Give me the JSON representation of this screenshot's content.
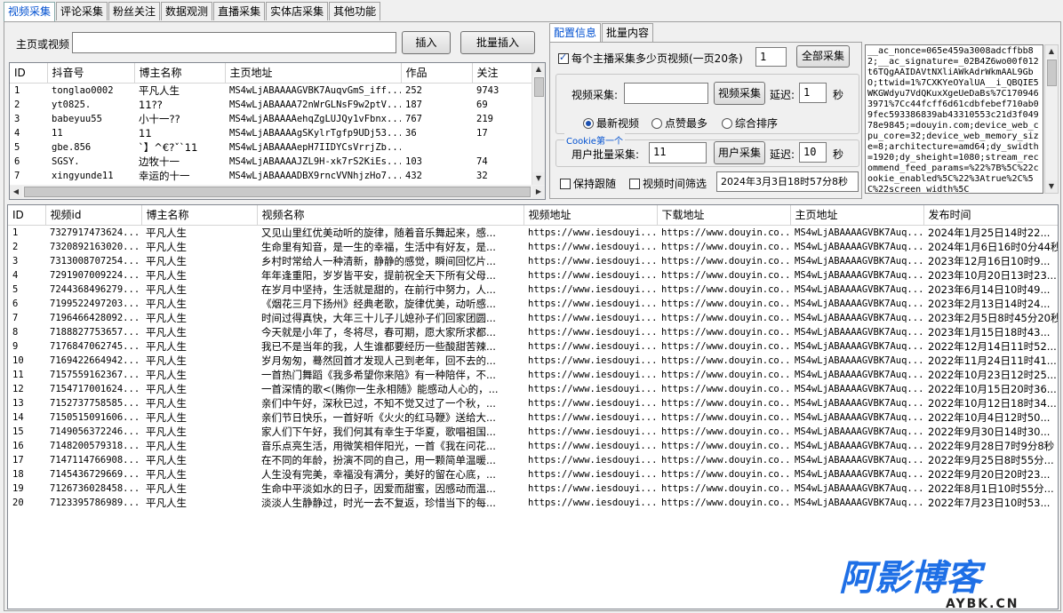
{
  "main_tabs": [
    "视频采集",
    "评论采集",
    "粉丝关注",
    "数据观测",
    "直播采集",
    "实体店采集",
    "其他功能"
  ],
  "top_form": {
    "homepage_label": "主页或视频",
    "homepage_value": "",
    "insert_btn": "插入",
    "batch_insert_btn": "批量插入"
  },
  "user_table": {
    "columns": [
      "ID",
      "抖音号",
      "博主名称",
      "主页地址",
      "作品",
      "关注"
    ],
    "rows": [
      [
        "1",
        "tonglao0002",
        "平凡人生",
        "MS4wLjABAAAAGVBK7AuqvGmS_iff...",
        "252",
        "9743"
      ],
      [
        "2",
        "yt0825.",
        "11??",
        "MS4wLjABAAAA72nWrGLNsF9w2ptV...",
        "187",
        "69"
      ],
      [
        "3",
        "babeyuu55",
        "小十一??",
        "MS4wLjABAAAAehqZgLUJQy1vFbnx...",
        "767",
        "219"
      ],
      [
        "4",
        "11",
        "11",
        "MS4wLjABAAAAgSKylrTgfp9UDj53...",
        "36",
        "17"
      ],
      [
        "5",
        "gbe.856",
        "`】^€?ˇ`11",
        "MS4wLjABAAAAepH7IIDYCsVrrjZb...",
        "",
        ""
      ],
      [
        "6",
        "SGSY.",
        "边牧十一",
        "MS4wLjABAAAAJZL9H-xk7rS2KiEs...",
        "103",
        "74"
      ],
      [
        "7",
        "xingyunde11",
        "幸运的十一",
        "MS4wLjABAAAADBX9rncVVNhjzHo7...",
        "432",
        "32"
      ]
    ]
  },
  "right_tabs": [
    "配置信息",
    "批量内容"
  ],
  "config": {
    "per_user_label": "每个主播采集多少页视频(一页20条)",
    "per_user_value": "1",
    "collect_all_btn": "全部采集",
    "video_collect_label": "视频采集:",
    "video_collect_value": "",
    "video_collect_btn": "视频采集",
    "delay_label": "延迟:",
    "delay_value_1": "1",
    "seconds": "秒",
    "sort_options": [
      "最新视频",
      "点赞最多",
      "综合排序"
    ],
    "cookie_group_label": "Cookie第一个",
    "user_batch_label": "用户批量采集:",
    "user_batch_value": "11",
    "user_collect_btn": "用户采集",
    "delay_value_2": "10",
    "keep_follow_label": "保持跟随",
    "video_time_filter_label": "视频时间筛选",
    "datetime_value": "2024年3月3日18时57分8秒"
  },
  "cookie_text": "__ac_nonce=065e459a3008adcffbb82;__ac_signature=_02B4Z6wo00f012t6TQgAAIDAVtNXliAWkAdrWkmAAL9GbO;ttwid=1%7CXKYeOYalUA__i_QBQIE5WKGWdyu7VdQKuxXgeUeDaBs%7C1709463971%7Cc44fcff6d61cdbfebef710ab09fec593386839ab43310553c21d3f04978e9845;=douyin.com;device_web_cpu_core=32;device_web_memory_size=8;architecture=amd64;dy_swidth=1920;dy_sheight=1080;stream_recommend_feed_params=%22%7B%5C%22cookie_enabled%5C%22%3Atrue%2C%5C%22screen_width%5C",
  "video_table": {
    "columns": [
      "ID",
      "视频id",
      "博主名称",
      "视频名称",
      "视频地址",
      "下载地址",
      "主页地址",
      "发布时间"
    ],
    "rows": [
      [
        "1",
        "7327917473624...",
        "平凡人生",
        "又见山里红优美动听的旋律，随着音乐舞起来，感...",
        "https://www.iesdouyi...",
        "https://www.douyin.co...",
        "MS4wLjABAAAAGVBK7Auq...",
        "2024年1月25日14时22..."
      ],
      [
        "2",
        "7320892163020...",
        "平凡人生",
        "生命里有知音，是一生的幸福，生活中有好友，是...",
        "https://www.iesdouyi...",
        "https://www.douyin.co...",
        "MS4wLjABAAAAGVBK7Auq...",
        "2024年1月6日16时0分44秒"
      ],
      [
        "3",
        "7313008707254...",
        "平凡人生",
        "乡村时常给人一种清新，静静的感觉，瞬间回忆片...",
        "https://www.iesdouyi...",
        "https://www.douyin.co...",
        "MS4wLjABAAAAGVBK7Auq...",
        "2023年12月16日10时9..."
      ],
      [
        "4",
        "7291907009224...",
        "平凡人生",
        "年年逢重阳，岁岁皆平安，提前祝全天下所有父母...",
        "https://www.iesdouyi...",
        "https://www.douyin.co...",
        "MS4wLjABAAAAGVBK7Auq...",
        "2023年10月20日13时23..."
      ],
      [
        "5",
        "7244368496279...",
        "平凡人生",
        "在岁月中坚持，生活就是甜的，在前行中努力，人...",
        "https://www.iesdouyi...",
        "https://www.douyin.co...",
        "MS4wLjABAAAAGVBK7Auq...",
        "2023年6月14日10时49..."
      ],
      [
        "6",
        "7199522497203...",
        "平凡人生",
        "《烟花三月下扬州》经典老歌，旋律优美，动听感...",
        "https://www.iesdouyi...",
        "https://www.douyin.co...",
        "MS4wLjABAAAAGVBK7Auq...",
        "2023年2月13日14时24..."
      ],
      [
        "7",
        "7196466428092...",
        "平凡人生",
        "时间过得真快，大年三十儿子儿媳孙子们回家团圆...",
        "https://www.iesdouyi...",
        "https://www.douyin.co...",
        "MS4wLjABAAAAGVBK7Auq...",
        "2023年2月5日8时45分20秒"
      ],
      [
        "8",
        "7188827753657...",
        "平凡人生",
        "今天就是小年了，冬将尽，春可期，愿大家所求都...",
        "https://www.iesdouyi...",
        "https://www.douyin.co...",
        "MS4wLjABAAAAGVBK7Auq...",
        "2023年1月15日18时43..."
      ],
      [
        "9",
        "7176847062745...",
        "平凡人生",
        "我已不是当年的我，人生谁都要经历一些酸甜苦辣...",
        "https://www.iesdouyi...",
        "https://www.douyin.co...",
        "MS4wLjABAAAAGVBK7Auq...",
        "2022年12月14日11时52..."
      ],
      [
        "10",
        "7169422664942...",
        "平凡人生",
        "岁月匆匆，蓦然回首才发现人己到老年，回不去的...",
        "https://www.iesdouyi...",
        "https://www.douyin.co...",
        "MS4wLjABAAAAGVBK7Auq...",
        "2022年11月24日11时41..."
      ],
      [
        "11",
        "7157559162367...",
        "平凡人生",
        "一首热门舞蹈《我多希望你来陪》有一种陪伴，不...",
        "https://www.iesdouyi...",
        "https://www.douyin.co...",
        "MS4wLjABAAAAGVBK7Auq...",
        "2022年10月23日12时25..."
      ],
      [
        "12",
        "7154717001624...",
        "平凡人生",
        "一首深情的歌<(賄你一生永相随》能感动人心的，...",
        "https://www.iesdouyi...",
        "https://www.douyin.co...",
        "MS4wLjABAAAAGVBK7Auq...",
        "2022年10月15日20时36..."
      ],
      [
        "13",
        "7152737758585...",
        "平凡人生",
        "亲们中午好，深秋已过，不知不觉又过了一个秋，...",
        "https://www.iesdouyi...",
        "https://www.douyin.co...",
        "MS4wLjABAAAAGVBK7Auq...",
        "2022年10月12日18时34..."
      ],
      [
        "14",
        "7150515091606...",
        "平凡人生",
        "亲们节日快乐，一首好听《火火的红马鞭》送给大...",
        "https://www.iesdouyi...",
        "https://www.douyin.co...",
        "MS4wLjABAAAAGVBK7Auq...",
        "2022年10月4日12时50..."
      ],
      [
        "15",
        "7149056372246...",
        "平凡人生",
        "家人们下午好，我们何其有幸生于华夏，歌唱祖国...",
        "https://www.iesdouyi...",
        "https://www.douyin.co...",
        "MS4wLjABAAAAGVBK7Auq...",
        "2022年9月30日14时30..."
      ],
      [
        "16",
        "7148200579318...",
        "平凡人生",
        "音乐点亮生活，用微笑相伴阳光，一首《我在问花...",
        "https://www.iesdouyi...",
        "https://www.douyin.co...",
        "MS4wLjABAAAAGVBK7Auq...",
        "2022年9月28日7时9分8秒"
      ],
      [
        "17",
        "7147114766908...",
        "平凡人生",
        "在不同的年龄，扮演不同的自己，用一颗简单温暖...",
        "https://www.iesdouyi...",
        "https://www.douyin.co...",
        "MS4wLjABAAAAGVBK7Auq...",
        "2022年9月25日8时55分..."
      ],
      [
        "18",
        "7145436729669...",
        "平凡人生",
        "人生没有完美，幸福没有满分，美好的留在心底，...",
        "https://www.iesdouyi...",
        "https://www.douyin.co...",
        "MS4wLjABAAAAGVBK7Auq...",
        "2022年9月20日20时23..."
      ],
      [
        "19",
        "7126736028458...",
        "平凡人生",
        "生命中平淡如水的日子，因爱而甜蜜，因感动而温...",
        "https://www.iesdouyi...",
        "https://www.douyin.co...",
        "MS4wLjABAAAAGVBK7Auq...",
        "2022年8月1日10时55分..."
      ],
      [
        "20",
        "7123395786989...",
        "平凡人生",
        "淡淡人生静静过，时光一去不复返，珍惜当下的每...",
        "https://www.iesdouyi...",
        "https://www.douyin.co...",
        "MS4wLjABAAAAGVBK7Auq...",
        "2022年7月23日10时53..."
      ]
    ]
  },
  "watermark": {
    "brand": "阿影博客",
    "domain": "AYBK.CN"
  },
  "colors": {
    "accent": "#0050d0",
    "watermark_blue": "#1e6fe6"
  }
}
